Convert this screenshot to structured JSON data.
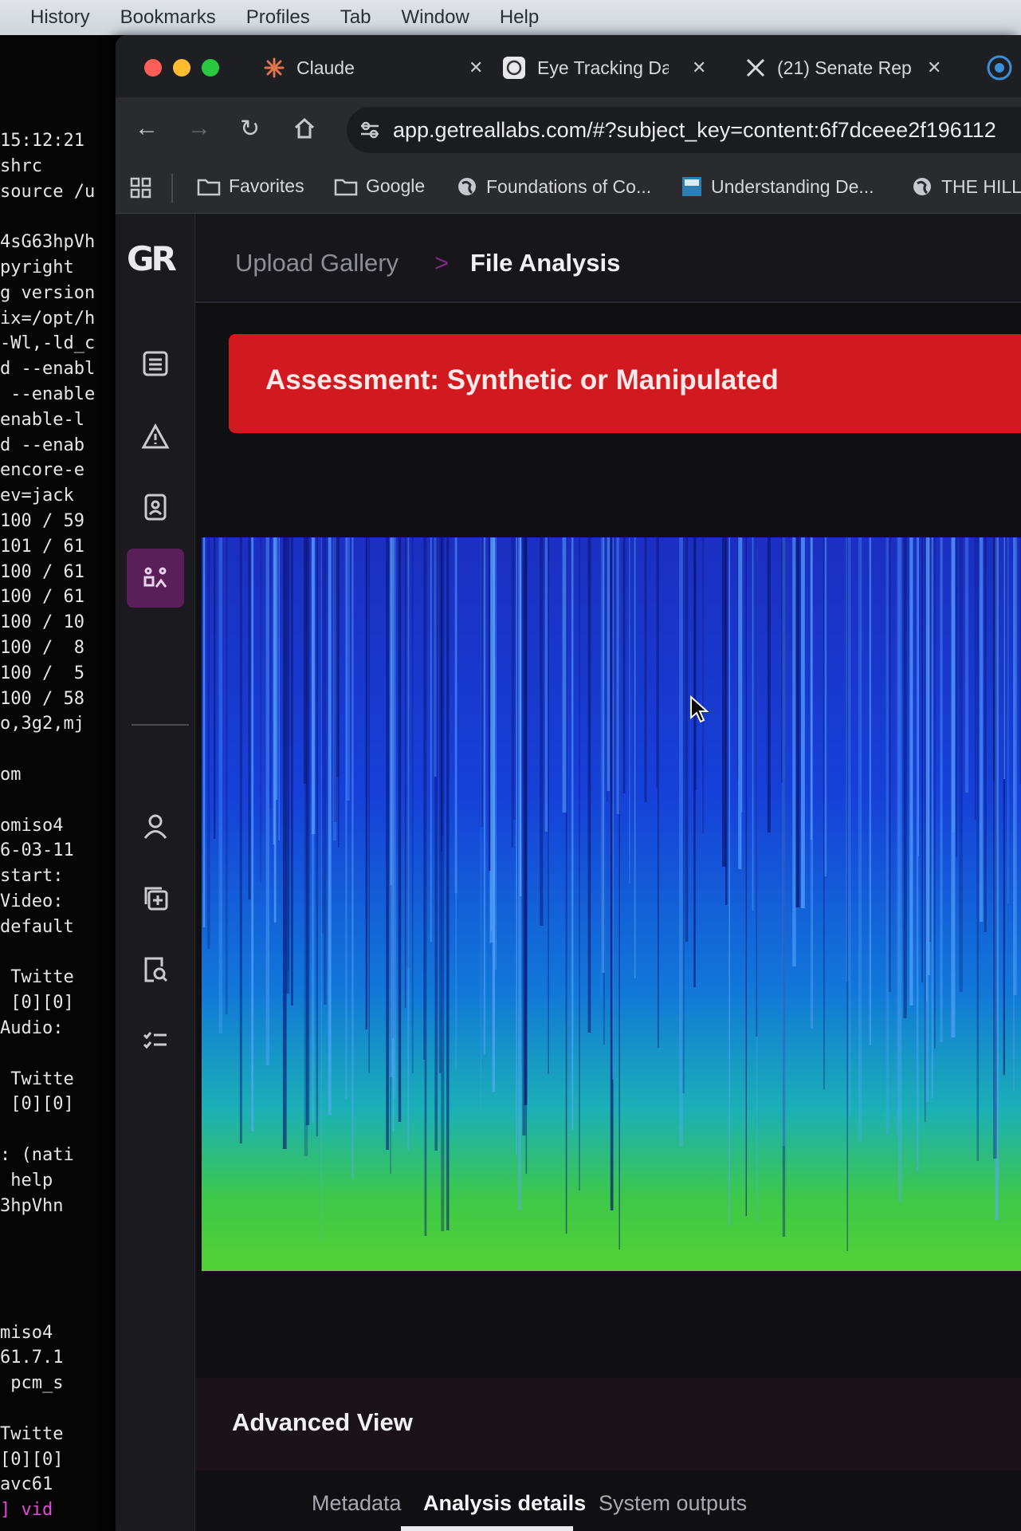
{
  "menubar": {
    "items": [
      "History",
      "Bookmarks",
      "Profiles",
      "Tab",
      "Window",
      "Help"
    ]
  },
  "terminal": {
    "lines": [
      "15:12:21",
      "shrc",
      "source /u",
      "",
      "4sG63hpVh",
      "pyright ",
      "g version",
      "ix=/opt/h",
      "-Wl,-ld_c",
      "d --enabl",
      " --enable",
      "enable-l",
      "d --enab",
      "encore-e",
      "ev=jack",
      "100 / 59",
      "101 / 61",
      "100 / 61",
      "100 / 61",
      "100 / 10",
      "100 /  8",
      "100 /  5",
      "100 / 58",
      "o,3g2,mj",
      "",
      "om",
      "",
      "omiso4",
      "6-03-11",
      "start:",
      "Video:",
      "default",
      "",
      " Twitte",
      " [0][0]",
      "Audio:",
      "",
      " Twitte",
      " [0][0]",
      "",
      ": (nati",
      " help",
      "3hpVhn",
      "",
      "",
      "",
      "",
      "miso4",
      "61.7.1",
      " pcm_s",
      "",
      "Twitte",
      "[0][0]",
      "avc61",
      "] vid"
    ],
    "accent_line": "] vid"
  },
  "browser": {
    "tabs": [
      {
        "title": "Claude",
        "icon": "claude-spark-icon"
      },
      {
        "title": "Eye Tracking Da",
        "icon": "openai-icon"
      },
      {
        "title": "(21) Senate Rep",
        "icon": "x-logo-icon"
      }
    ],
    "url": "app.getreallabs.com/#?subject_key=content:6f7dceee2f196112",
    "bookmarks": [
      {
        "label": "Favorites",
        "icon": "folder-icon"
      },
      {
        "label": "Google",
        "icon": "folder-icon"
      },
      {
        "label": "Foundations of Co...",
        "icon": "globe-icon"
      },
      {
        "label": "Understanding De...",
        "icon": "page-icon"
      },
      {
        "label": "THE HILL",
        "icon": "globe-icon"
      }
    ]
  },
  "app": {
    "logo": "GR",
    "breadcrumb": {
      "parent": "Upload Gallery",
      "separator": ">",
      "current": "File Analysis"
    },
    "assessment": "Assessment: Synthetic or Manipulated",
    "advanced_title": "Advanced View",
    "tabs": [
      "Metadata",
      "Analysis details",
      "System outputs"
    ],
    "active_tab": "Analysis details",
    "rail_icons": [
      "list-icon",
      "warning-icon",
      "id-badge-icon",
      "analysis-icon",
      "user-icon",
      "copy-add-icon",
      "document-search-icon",
      "checklist-icon"
    ],
    "colors": {
      "banner": "#d11a1f",
      "active_rail": "#5a1f58",
      "breadcrumb_sep": "#7d2a86"
    }
  }
}
